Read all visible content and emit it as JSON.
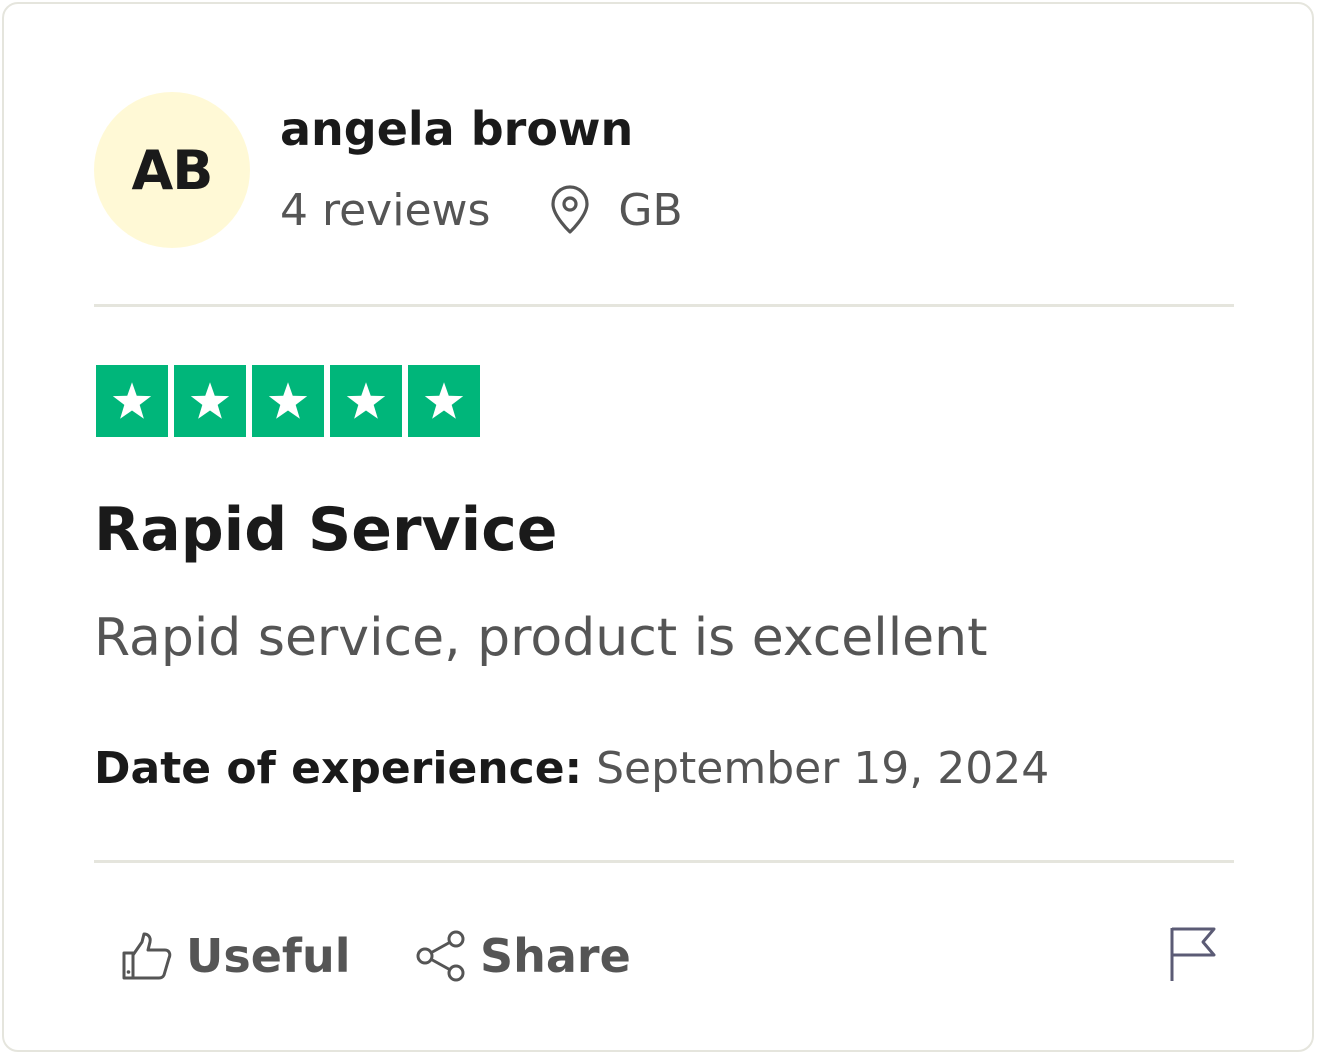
{
  "reviewer": {
    "initials": "AB",
    "name": "angela brown",
    "review_count": "4 reviews",
    "country": "GB",
    "avatar_color": "#fff9d6"
  },
  "rating": {
    "stars": 5,
    "max_stars": 5,
    "star_color": "#00b67a"
  },
  "review": {
    "title": "Rapid Service",
    "body": "Rapid service, product is excellent",
    "experience_label": "Date of experience:",
    "experience_date": "September 19, 2024"
  },
  "actions": {
    "useful_label": "Useful",
    "useful_icon": "thumbs-up-icon",
    "share_label": "Share",
    "share_icon": "share-icon",
    "report_icon": "flag-icon"
  },
  "icons": {
    "location": "location-pin-icon"
  }
}
